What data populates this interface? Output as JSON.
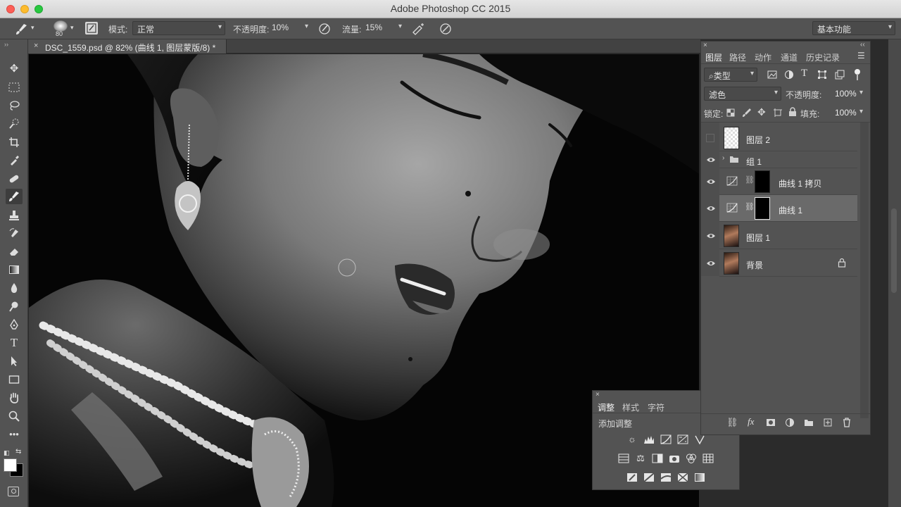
{
  "window": {
    "title": "Adobe Photoshop CC 2015"
  },
  "options_bar": {
    "brush_size": "80",
    "mode_label": "模式:",
    "mode_value": "正常",
    "opacity_label": "不透明度:",
    "opacity_value": "10%",
    "flow_label": "流量:",
    "flow_value": "15%",
    "workspace": "基本功能"
  },
  "document_tab": {
    "label": "DSC_1559.psd @ 82% (曲线 1, 图层蒙版/8) *"
  },
  "layers_panel": {
    "tabs": [
      "图层",
      "路径",
      "动作",
      "通道",
      "历史记录"
    ],
    "filter_kind": "类型",
    "blend_mode": "滤色",
    "opacity_label": "不透明度:",
    "opacity_value": "100%",
    "lock_label": "锁定:",
    "fill_label": "填充:",
    "fill_value": "100%",
    "layers": [
      {
        "name": "图层 2",
        "visible": false
      },
      {
        "name": "组 1",
        "visible": true
      },
      {
        "name": "曲线 1 拷贝",
        "visible": true
      },
      {
        "name": "曲线 1",
        "visible": true,
        "selected": true
      },
      {
        "name": "图层 1",
        "visible": true
      },
      {
        "name": "背景",
        "visible": true,
        "locked": true
      }
    ]
  },
  "adjustments_panel": {
    "tabs": [
      "调整",
      "样式",
      "字符"
    ],
    "heading": "添加调整"
  },
  "colors": {
    "ui_bg": "#535353",
    "canvas_bg": "#050505",
    "selected_row": "#6a6a6a"
  }
}
